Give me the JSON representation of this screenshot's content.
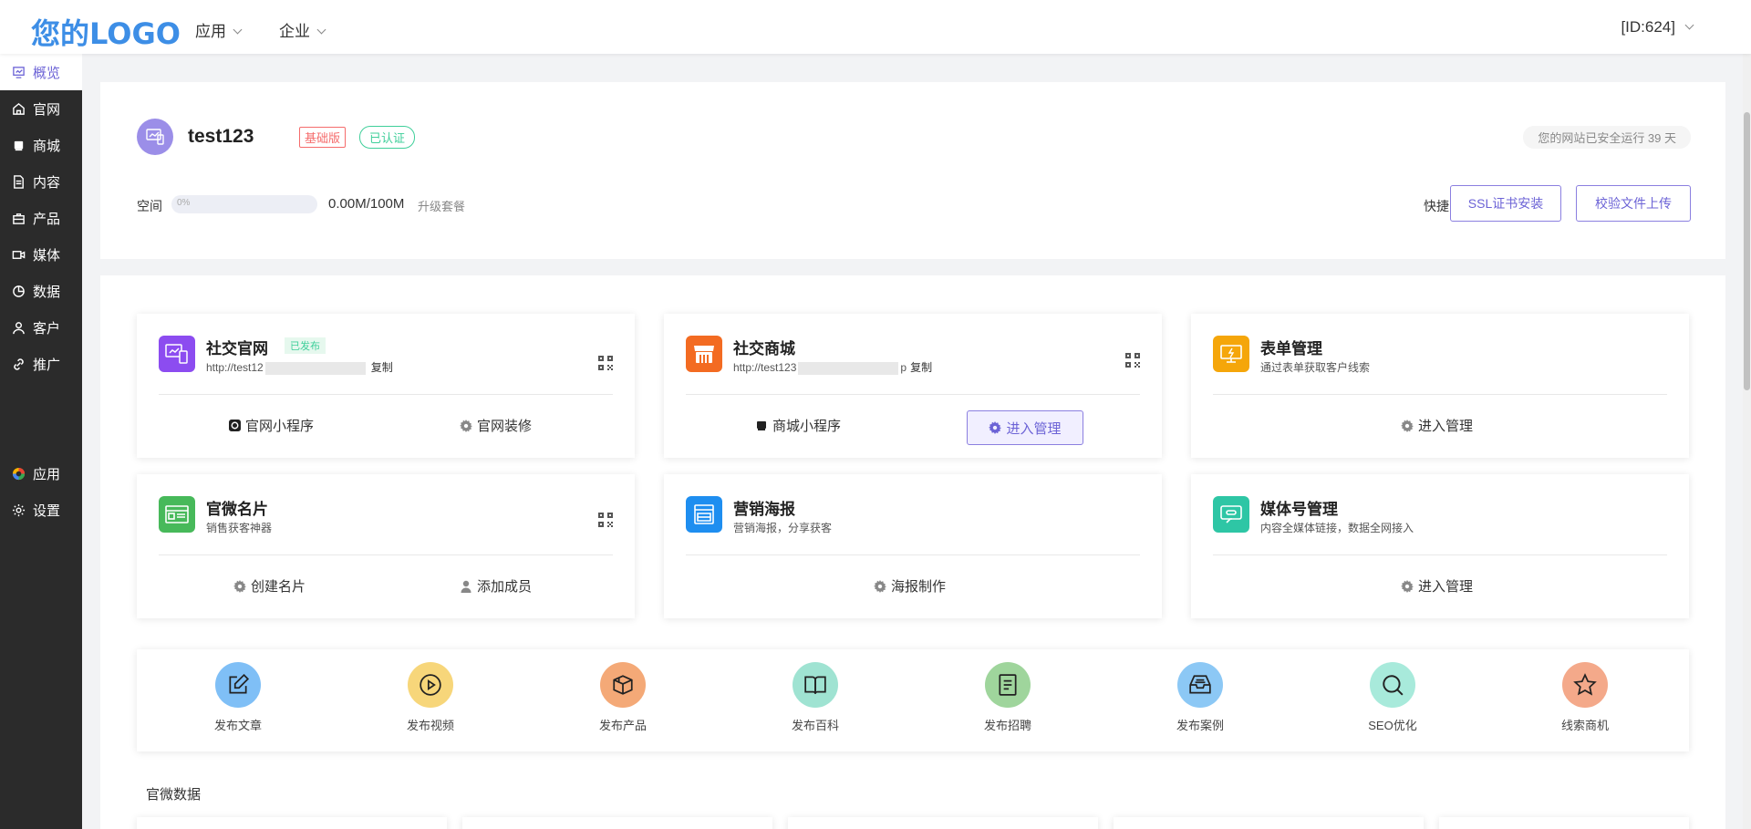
{
  "header": {
    "logo": "您的LOGO",
    "nav": [
      {
        "label": "应用"
      },
      {
        "label": "企业"
      }
    ],
    "user_id": "[ID:624]"
  },
  "sidebar": {
    "top_items": [
      {
        "label": "概览",
        "icon": "overview-icon",
        "active": true
      },
      {
        "label": "官网",
        "icon": "home-icon"
      },
      {
        "label": "商城",
        "icon": "shop-icon"
      },
      {
        "label": "内容",
        "icon": "document-icon"
      },
      {
        "label": "产品",
        "icon": "product-icon"
      },
      {
        "label": "媒体",
        "icon": "video-icon"
      },
      {
        "label": "数据",
        "icon": "pie-chart-icon"
      },
      {
        "label": "客户",
        "icon": "user-icon"
      },
      {
        "label": "推广",
        "icon": "link-icon"
      }
    ],
    "bottom_items": [
      {
        "label": "应用",
        "icon": "apps-icon"
      },
      {
        "label": "设置",
        "icon": "gear-icon"
      }
    ]
  },
  "site": {
    "name": "test123",
    "plan_badge": "基础版",
    "verified_badge": "已认证",
    "uptime": "您的网站已安全运行 39 天",
    "space_label": "空间",
    "space_percent_label": "0%",
    "space_fraction": 0,
    "space_value": "0.00M/100M",
    "upgrade_label": "升级套餐",
    "quick_label": "快捷",
    "ssl_button": "SSL证书安装",
    "verify_button": "校验文件上传"
  },
  "cards": [
    {
      "title": "社交官网",
      "verified": "已发布",
      "url": "http://test12",
      "copy": "复制",
      "actions": [
        "官网小程序",
        "官网装修"
      ],
      "color": "#8c4cf0"
    },
    {
      "title": "社交商城",
      "url": "http://test123",
      "url_tail": "p",
      "copy": "复制",
      "actions": [
        "商城小程序",
        "进入管理"
      ],
      "color": "#f36b22"
    },
    {
      "title": "表单管理",
      "subtitle": "通过表单获取客户线索",
      "actions": [
        "进入管理"
      ],
      "color": "#f5a60a"
    },
    {
      "title": "官微名片",
      "subtitle": "销售获客神器",
      "actions": [
        "创建名片",
        "添加成员"
      ],
      "color": "#47b95a"
    },
    {
      "title": "营销海报",
      "subtitle": "营销海报，分享获客",
      "actions": [
        "海报制作"
      ],
      "color": "#1e8ef0"
    },
    {
      "title": "媒体号管理",
      "subtitle": "内容全媒体链接，数据全网接入",
      "actions": [
        "进入管理"
      ],
      "color": "#2ec6a5"
    }
  ],
  "quick_actions": [
    {
      "label": "发布文章",
      "icon": "edit-icon",
      "color": "#7fbff6"
    },
    {
      "label": "发布视频",
      "icon": "play-icon",
      "color": "#f7d67a"
    },
    {
      "label": "发布产品",
      "icon": "box-icon",
      "color": "#f4a977"
    },
    {
      "label": "发布百科",
      "icon": "book-icon",
      "color": "#9fe3d2"
    },
    {
      "label": "发布招聘",
      "icon": "list-icon",
      "color": "#9fd59c"
    },
    {
      "label": "发布案例",
      "icon": "inbox-icon",
      "color": "#8cc8f5"
    },
    {
      "label": "SEO优化",
      "icon": "search-icon",
      "color": "#a8eadb"
    },
    {
      "label": "线索商机",
      "icon": "star-icon",
      "color": "#f4a98a"
    }
  ],
  "section": {
    "data_title": "官微数据"
  }
}
